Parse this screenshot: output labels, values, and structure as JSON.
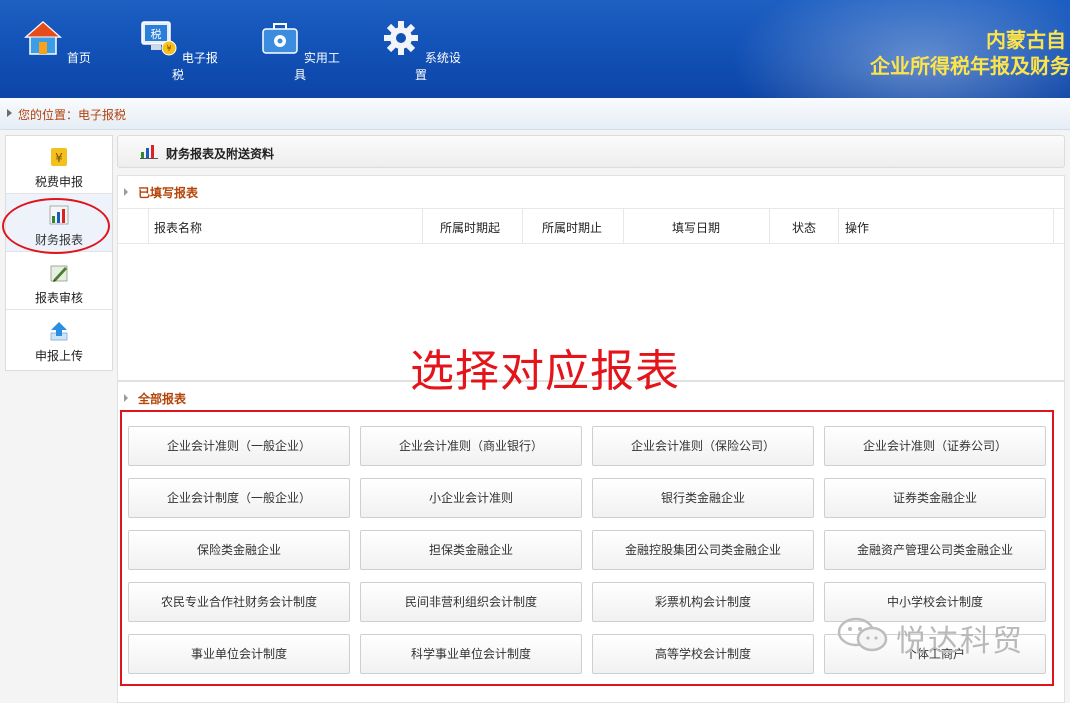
{
  "header": {
    "nav": [
      {
        "label": "首页",
        "icon": "home-icon"
      },
      {
        "label": "电子报税",
        "icon": "tax-monitor-icon"
      },
      {
        "label": "实用工具",
        "icon": "toolbox-icon"
      },
      {
        "label": "系统设置",
        "icon": "gear-icon"
      }
    ],
    "title_line1": "内蒙古自",
    "title_line2": "企业所得税年报及财务"
  },
  "breadcrumb": {
    "text": "您的位置：电子报税"
  },
  "sidebar": {
    "items": [
      {
        "label": "税费申报",
        "icon": "yuan-icon"
      },
      {
        "label": "财务报表",
        "icon": "bar-chart-icon"
      },
      {
        "label": "报表审核",
        "icon": "pen-icon"
      },
      {
        "label": "申报上传",
        "icon": "upload-arrow-icon"
      }
    ],
    "active_index": 1
  },
  "panel": {
    "title": "财务报表及附送资料"
  },
  "filled": {
    "title": "已填写报表",
    "columns": [
      "报表名称",
      "所属时期起",
      "所属时期止",
      "填写日期",
      "状态",
      "操作"
    ]
  },
  "all": {
    "title": "全部报表",
    "rows": [
      [
        "企业会计准则（一般企业）",
        "企业会计准则（商业银行）",
        "企业会计准则（保险公司）",
        "企业会计准则（证券公司）"
      ],
      [
        "企业会计制度（一般企业）",
        "小企业会计准则",
        "银行类金融企业",
        "证券类金融企业"
      ],
      [
        "保险类金融企业",
        "担保类金融企业",
        "金融控股集团公司类金融企业",
        "金融资产管理公司类金融企业"
      ],
      [
        "农民专业合作社财务会计制度",
        "民间非营利组织会计制度",
        "彩票机构会计制度",
        "中小学校会计制度"
      ],
      [
        "事业单位会计制度",
        "科学事业单位会计制度",
        "高等学校会计制度",
        "个体工商户"
      ]
    ]
  },
  "annotation": {
    "text": "选择对应报表"
  },
  "watermark": {
    "text": "悦达科贸"
  },
  "colors": {
    "header": "#1150b5",
    "title_yellow": "#fde44a",
    "accent_red": "#e0141b",
    "section_title": "#b4440a"
  }
}
